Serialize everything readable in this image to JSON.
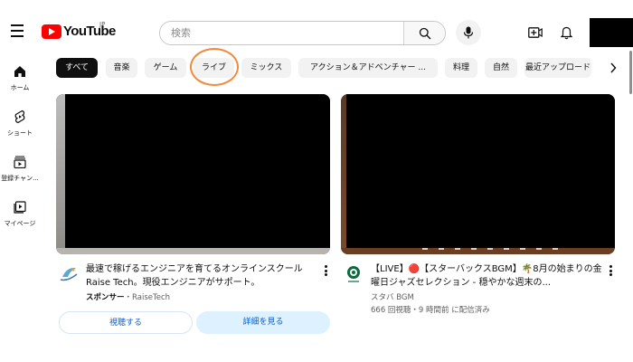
{
  "header": {
    "logo_text": "YouTube",
    "region": "JP",
    "search_placeholder": "検索",
    "icons": [
      "menu-icon",
      "search-icon",
      "mic-icon",
      "create-icon",
      "bell-icon"
    ]
  },
  "sidebar": {
    "items": [
      {
        "label": "ホーム",
        "icon": "home-icon"
      },
      {
        "label": "ショート",
        "icon": "shorts-icon"
      },
      {
        "label": "登録チャン...",
        "icon": "subscriptions-icon"
      },
      {
        "label": "マイページ",
        "icon": "library-icon"
      }
    ]
  },
  "chips": [
    {
      "label": "すべて",
      "active": true
    },
    {
      "label": "音楽"
    },
    {
      "label": "ゲーム"
    },
    {
      "label": "ライブ"
    },
    {
      "label": "ミックス"
    },
    {
      "label": "アクション＆アドベンチャー ..."
    },
    {
      "label": "料理"
    },
    {
      "label": "自然"
    },
    {
      "label": "最近アップロード"
    }
  ],
  "highlight_color": "#f08a3c",
  "videos": [
    {
      "title": "最速で稼げるエンジニアを育てるオンラインスクールRaise Tech。現役エンジニアがサポート。",
      "sponsor_label": "スポンサー",
      "separator": "・",
      "channel": "RaiseTech",
      "button_primary": "視聴する",
      "button_secondary": "詳細を見る"
    },
    {
      "title": "【LIVE】🔴【スターバックスBGM】🌴8月の始まりの金曜日ジャズセレクション - 穏やかな週末の...",
      "channel": "スタバ BGM",
      "stats": "666 回視聴・9 時間前 に配信済み"
    }
  ]
}
